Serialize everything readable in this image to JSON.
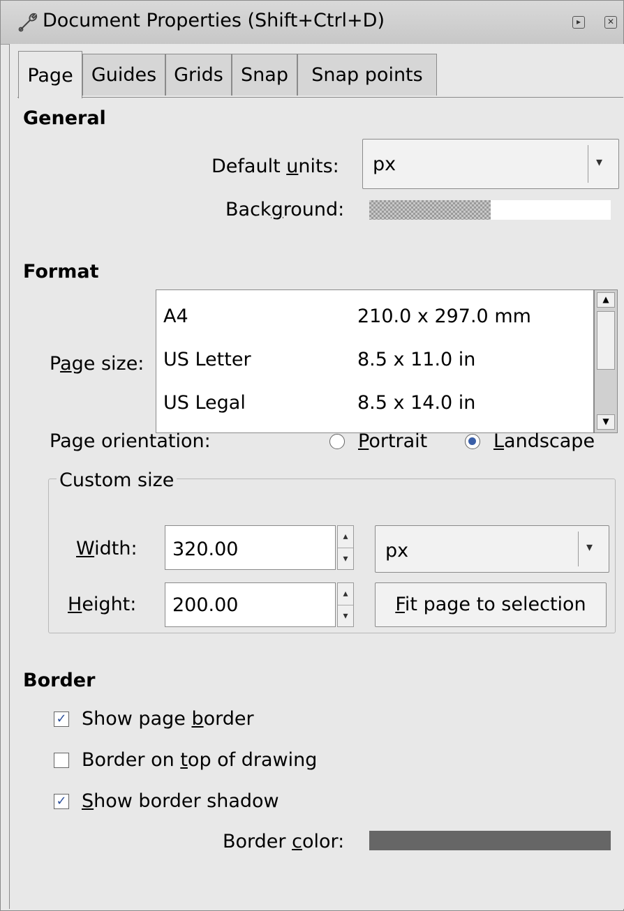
{
  "window": {
    "title": "Document Properties (Shift+Ctrl+D)",
    "title_icon": "wrench-icon",
    "buttons": [
      "restore-icon",
      "close-icon"
    ]
  },
  "tabs": [
    {
      "label": "Page",
      "active": true
    },
    {
      "label": "Guides",
      "active": false
    },
    {
      "label": "Grids",
      "active": false
    },
    {
      "label": "Snap",
      "active": false
    },
    {
      "label": "Snap points",
      "active": false
    }
  ],
  "general": {
    "heading": "General",
    "units_label_pre": "Default ",
    "units_label_u": "u",
    "units_label_post": "nits:",
    "units_value": "px",
    "background_label_pre": "Back",
    "background_label_u": "g",
    "background_label_post": "round:"
  },
  "format": {
    "heading": "Format",
    "page_size_label_pre": "P",
    "page_size_label_u": "a",
    "page_size_label_post": "ge size:",
    "page_sizes": [
      {
        "name": "A4",
        "size": "210.0 x 297.0 mm"
      },
      {
        "name": "US Letter",
        "size": "8.5 x 11.0 in"
      },
      {
        "name": "US Legal",
        "size": "8.5 x 14.0 in"
      }
    ],
    "orientation_label": "Page orientation:",
    "portrait_u": "P",
    "portrait_rest": "ortrait",
    "landscape_u": "L",
    "landscape_rest": "andscape",
    "orientation_selected": "Landscape"
  },
  "custom_size": {
    "legend": "Custom size",
    "width_u": "W",
    "width_rest": "idth:",
    "width_value": "320.00",
    "height_u": "H",
    "height_rest": "eight:",
    "height_value": "200.00",
    "units_value": "px",
    "fit_u": "F",
    "fit_rest": "it page to selection"
  },
  "border": {
    "heading": "Border",
    "show_border_pre": "Show page ",
    "show_border_u": "b",
    "show_border_post": "order",
    "show_border_checked": true,
    "on_top_pre": "Border on ",
    "on_top_u": "t",
    "on_top_post": "op of drawing",
    "on_top_checked": false,
    "shadow_u": "S",
    "shadow_rest": "how border shadow",
    "shadow_checked": true,
    "color_label_pre": "Border ",
    "color_label_u": "c",
    "color_label_post": "olor:",
    "color_value": "#666666"
  }
}
